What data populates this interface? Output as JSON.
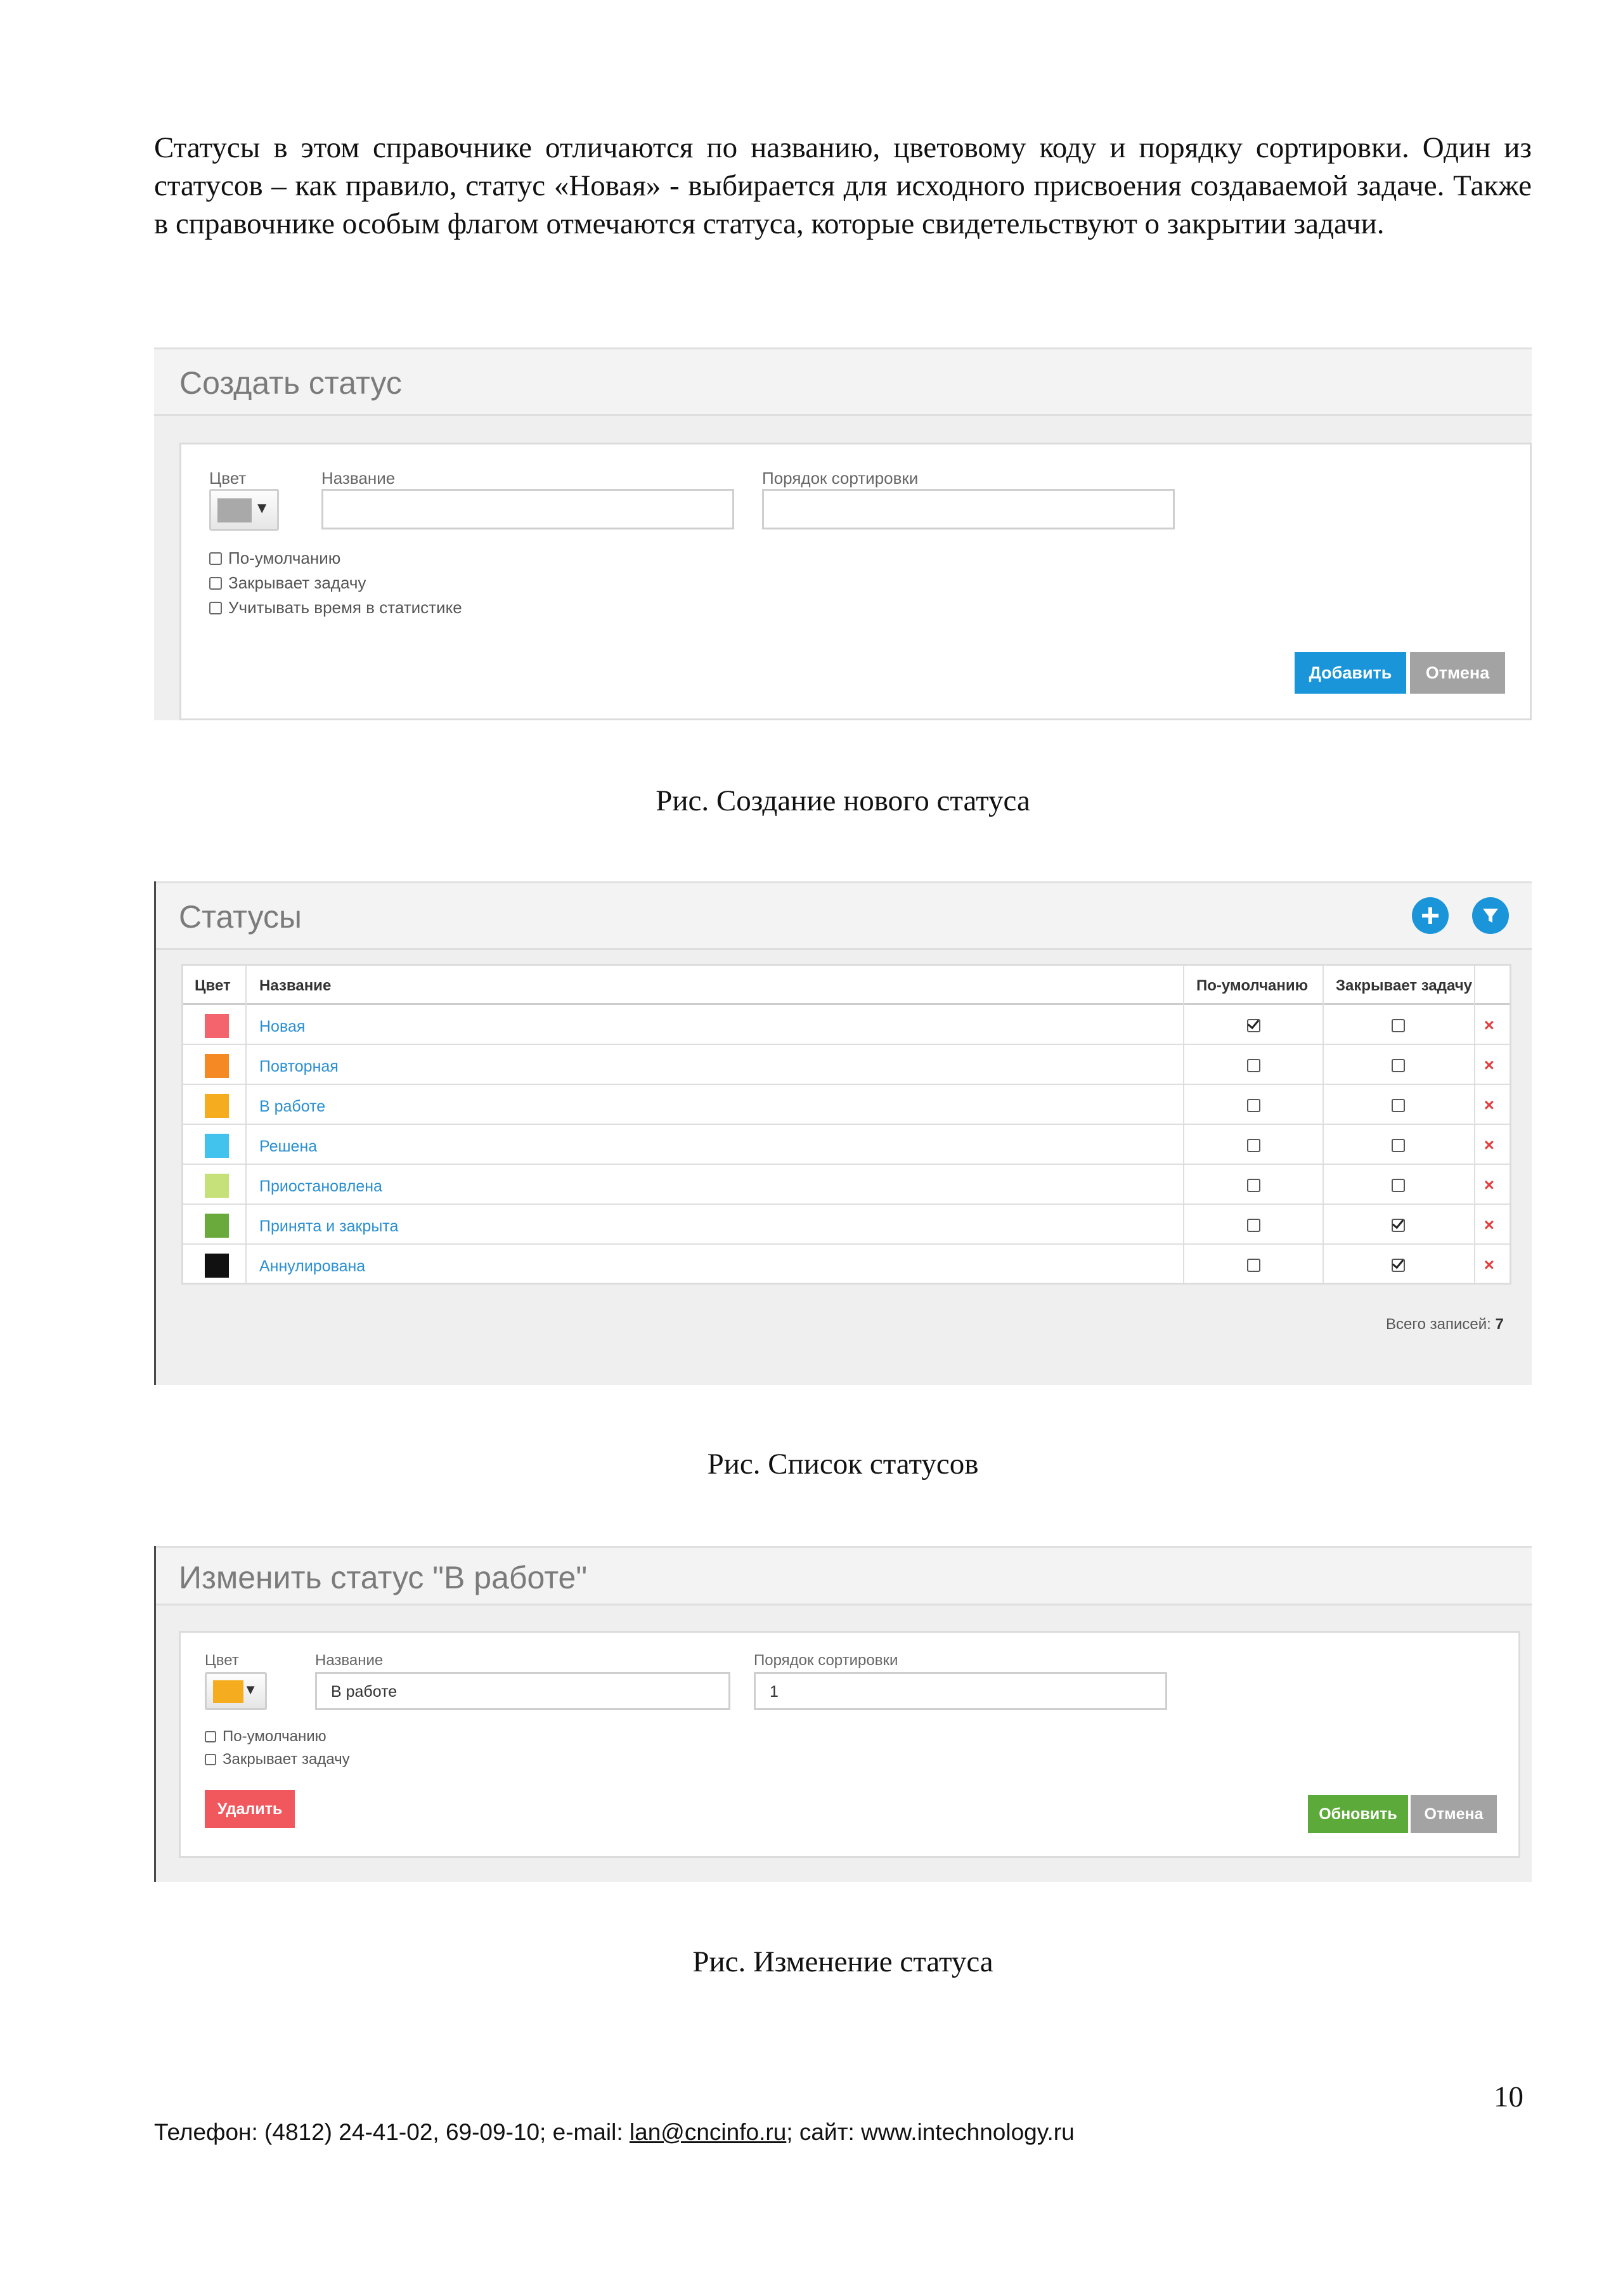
{
  "intro": "Статусы в этом справочнике отличаются по названию, цветовому коду и порядку сортировки. Один из статусов – как правило, статус «Новая» - выбирается для исходного присвоения создаваемой задаче. Также в справочнике особым флагом отмечаются статуса, которые свидетельствуют о закрытии задачи.",
  "create": {
    "title": "Создать статус",
    "color_label": "Цвет",
    "color_value": "#a9a9a9",
    "name_label": "Название",
    "name_value": "",
    "sort_label": "Порядок сортировки",
    "sort_value": "",
    "checkboxes": [
      "По-умолчанию",
      "Закрывает задачу",
      "Учитывать время в статистике"
    ],
    "add_button": "Добавить",
    "cancel_button": "Отмена",
    "caption": "Рис. Создание нового статуса"
  },
  "list": {
    "title": "Статусы",
    "columns": [
      "Цвет",
      "Название",
      "По-умолчанию",
      "Закрывает задачу"
    ],
    "rows": [
      {
        "name": "Новая",
        "color": "#f4646c",
        "default": true,
        "closes": false
      },
      {
        "name": "Повторная",
        "color": "#f58a24",
        "default": false,
        "closes": false
      },
      {
        "name": "В работе",
        "color": "#f5ad1f",
        "default": false,
        "closes": false
      },
      {
        "name": "Решена",
        "color": "#41c3ee",
        "default": false,
        "closes": false
      },
      {
        "name": "Приостановлена",
        "color": "#c6e07a",
        "default": false,
        "closes": false
      },
      {
        "name": "Принята и закрыта",
        "color": "#6aaa3c",
        "default": false,
        "closes": true
      },
      {
        "name": "Аннулирована",
        "color": "#111111",
        "default": false,
        "closes": true
      }
    ],
    "total_label": "Всего записей:",
    "total_value": "7",
    "caption": "Рис. Список статусов"
  },
  "edit": {
    "title": "Изменить статус \"В работе\"",
    "color_label": "Цвет",
    "color_value": "#f5ad1f",
    "name_label": "Название",
    "name_value": "В работе",
    "sort_label": "Порядок сортировки",
    "sort_value": "1",
    "checkboxes": [
      "По-умолчанию",
      "Закрывает задачу"
    ],
    "delete_button": "Удалить",
    "update_button": "Обновить",
    "cancel_button": "Отмена",
    "caption": "Рис. Изменение статуса"
  },
  "footer": {
    "phone": "Телефон: (4812) 24-41-02, 69-09-10; e-mail: ",
    "email": "lan@cncinfo.ru",
    "site": "; сайт: www.intechnology.ru"
  },
  "page_number": "10"
}
